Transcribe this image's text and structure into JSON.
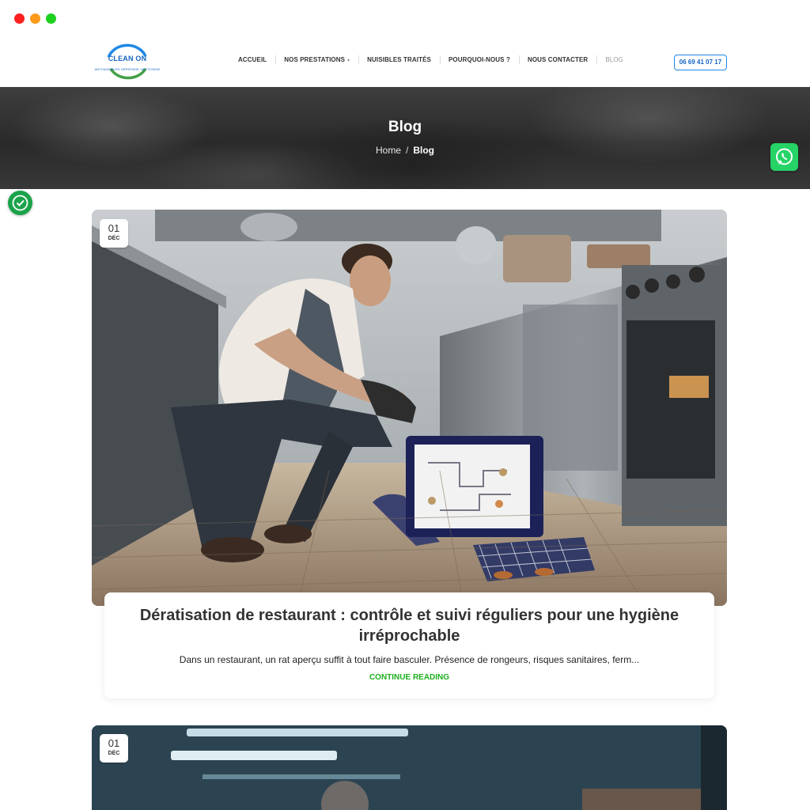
{
  "window": {
    "controls": [
      "close",
      "minimize",
      "maximize"
    ]
  },
  "header": {
    "logo": {
      "name": "CLEAN ON",
      "tagline": "ANTI-NUISIBLES, DÉPISTAGE, NETTOYAGE"
    },
    "nav": [
      {
        "label": "ACCUEIL"
      },
      {
        "label": "NOS PRESTATIONS",
        "has_dropdown": true
      },
      {
        "label": "NUISIBLES TRAITÉS"
      },
      {
        "label": "POURQUOI-NOUS ?"
      },
      {
        "label": "NOUS CONTACTER"
      },
      {
        "label": "BLOG",
        "active": true
      }
    ],
    "phone": "06 69 41 07 17"
  },
  "hero": {
    "title": "Blog",
    "breadcrumb": {
      "home": "Home",
      "separator": "/",
      "current": "Blog"
    }
  },
  "posts": [
    {
      "date_day": "01",
      "date_month": "DÉC",
      "title": "Dératisation de restaurant : contrôle et suivi réguliers pour une hygiène irréprochable",
      "excerpt": "Dans un restaurant, un rat aperçu suffit à tout faire basculer. Présence de rongeurs, risques sanitaires, ferm...",
      "read_more": "CONTINUE READING",
      "image": "pest-control-technician-in-restaurant-kitchen"
    },
    {
      "date_day": "01",
      "date_month": "DÉC",
      "image": "restaurant-kitchen-photo"
    }
  ],
  "floating": {
    "whatsapp_icon": "whatsapp-icon",
    "accessibility_icon": "accessibility-icon"
  },
  "colors": {
    "accent_green": "#1db01d",
    "brand_blue": "#1565c0",
    "whatsapp": "#25d366"
  }
}
